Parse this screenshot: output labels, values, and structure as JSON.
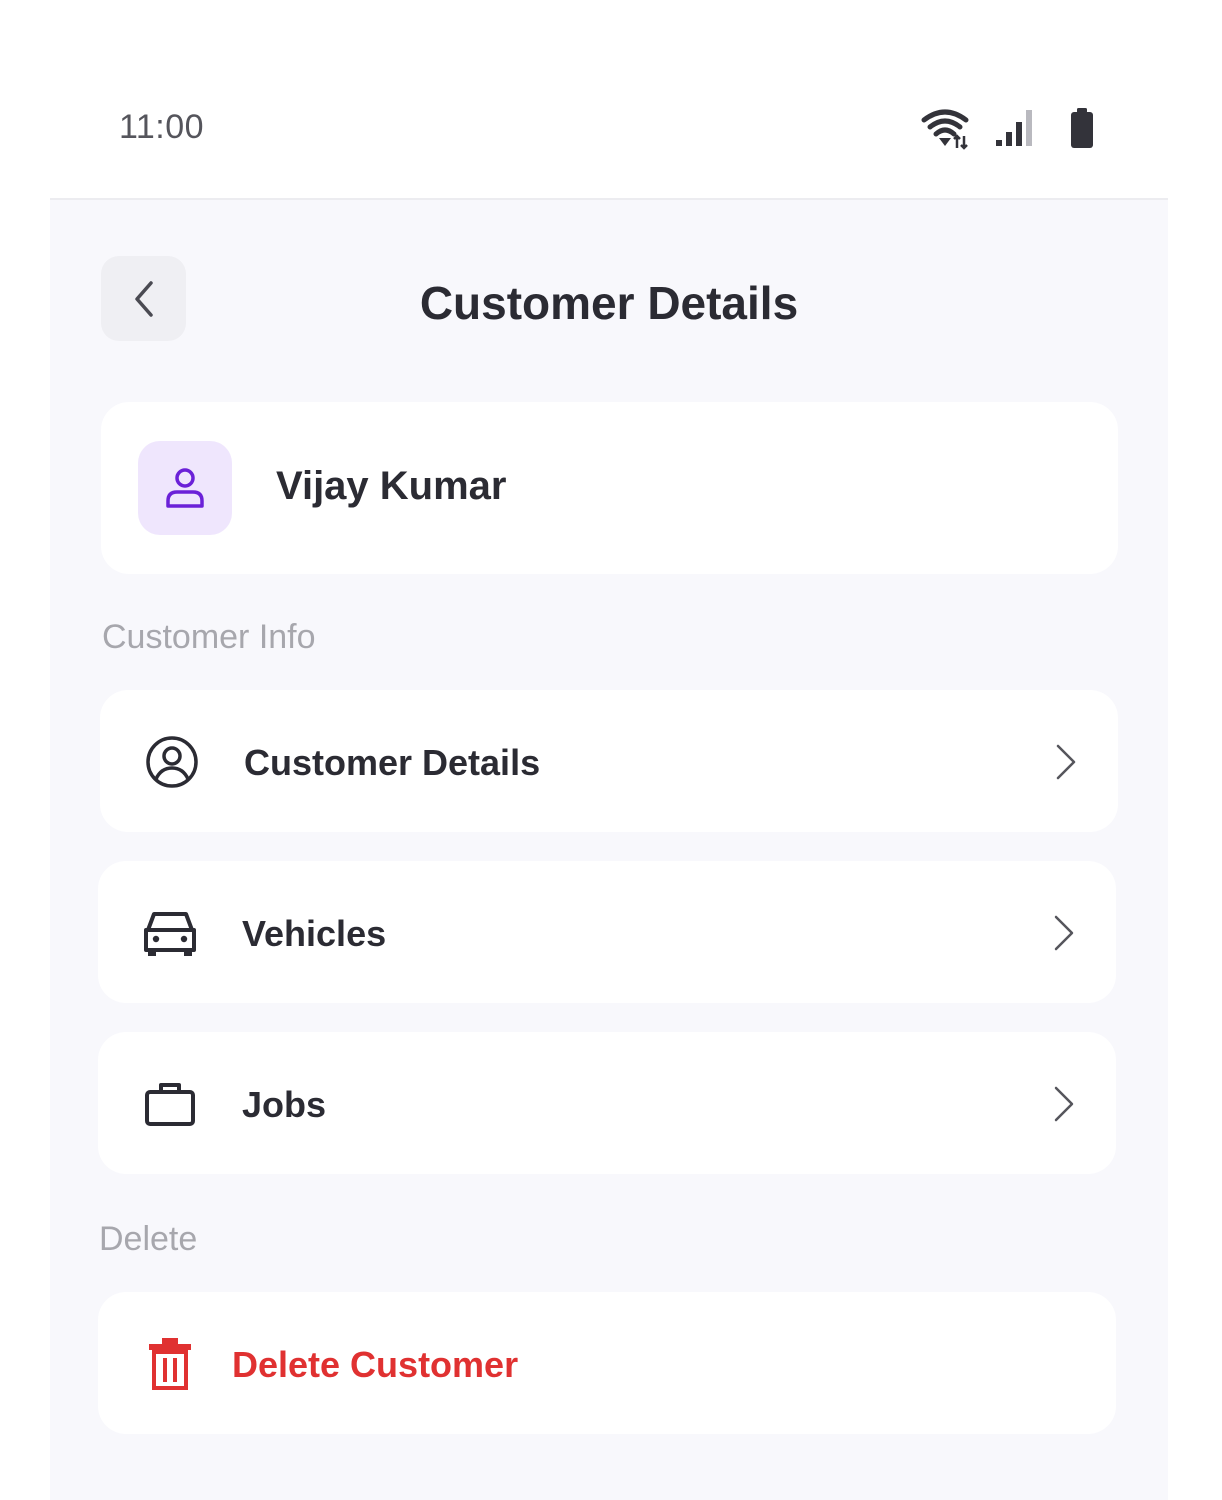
{
  "status_bar": {
    "time": "11:00",
    "icons": [
      "wifi-icon",
      "signal-icon",
      "battery-icon"
    ]
  },
  "header": {
    "title": "Customer Details",
    "back_icon": "chevron-left-icon"
  },
  "profile": {
    "name": "Vijay Kumar",
    "avatar_icon": "user-icon",
    "accent_color": "#6b21d8"
  },
  "sections": {
    "customer_info_label": "Customer Info",
    "delete_label": "Delete"
  },
  "menu": {
    "customer_details": {
      "label": "Customer Details",
      "icon": "user-circle-icon"
    },
    "vehicles": {
      "label": "Vehicles",
      "icon": "car-icon"
    },
    "jobs": {
      "label": "Jobs",
      "icon": "briefcase-icon"
    }
  },
  "delete_action": {
    "label": "Delete Customer",
    "icon": "trash-icon",
    "color": "#e03131"
  }
}
